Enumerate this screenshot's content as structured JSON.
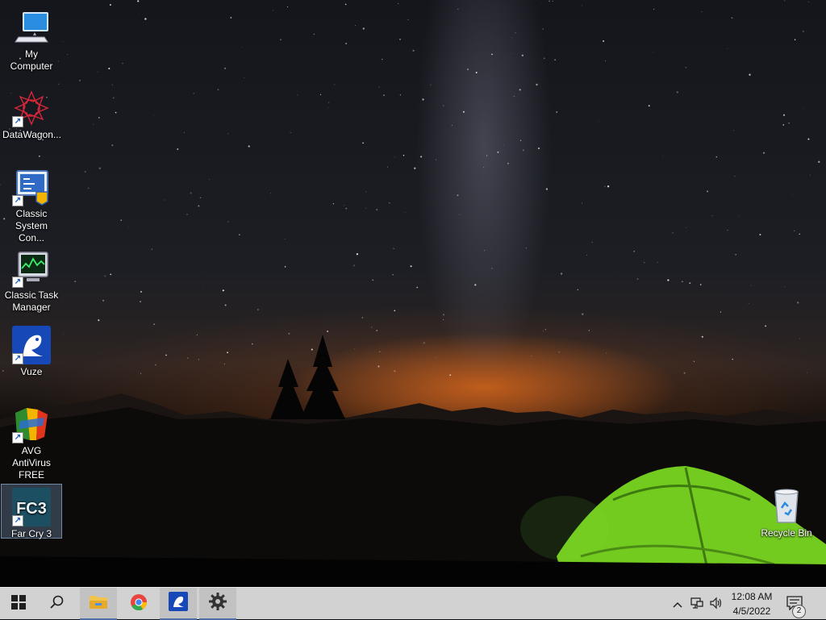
{
  "desktop": {
    "icons": [
      {
        "label": "My Computer",
        "icon": "computer-icon"
      },
      {
        "label": "DataWagon...",
        "icon": "datawagon-icon"
      },
      {
        "label": "Classic System Con...",
        "icon": "control-panel-icon"
      },
      {
        "label": "Classic Task Manager",
        "icon": "task-manager-icon"
      },
      {
        "label": "Vuze",
        "icon": "vuze-frog-icon"
      },
      {
        "label": "AVG AntiVirus FREE",
        "icon": "avg-antivirus-icon"
      },
      {
        "label": "Far Cry 3",
        "icon": "far-cry-3-icon",
        "logo_text": "FC3",
        "selected": true
      },
      {
        "label": "Recycle Bin",
        "icon": "recycle-bin-icon"
      }
    ]
  },
  "taskbar": {
    "start": "windows-start-icon",
    "search": "search-icon",
    "pinned": [
      "file-explorer-icon",
      "chrome-icon",
      "vuze-icon",
      "settings-gear-icon"
    ],
    "tray": {
      "overflow": "chevron-up-icon",
      "network": "network-icon",
      "volume": "volume-icon",
      "time": "12:08 AM",
      "date": "4/5/2022",
      "notification_count": "2"
    }
  },
  "colors": {
    "taskbar_bg": "#d2d2d2",
    "accent": "#4f6ea8",
    "tent_green": "#7ee022"
  }
}
